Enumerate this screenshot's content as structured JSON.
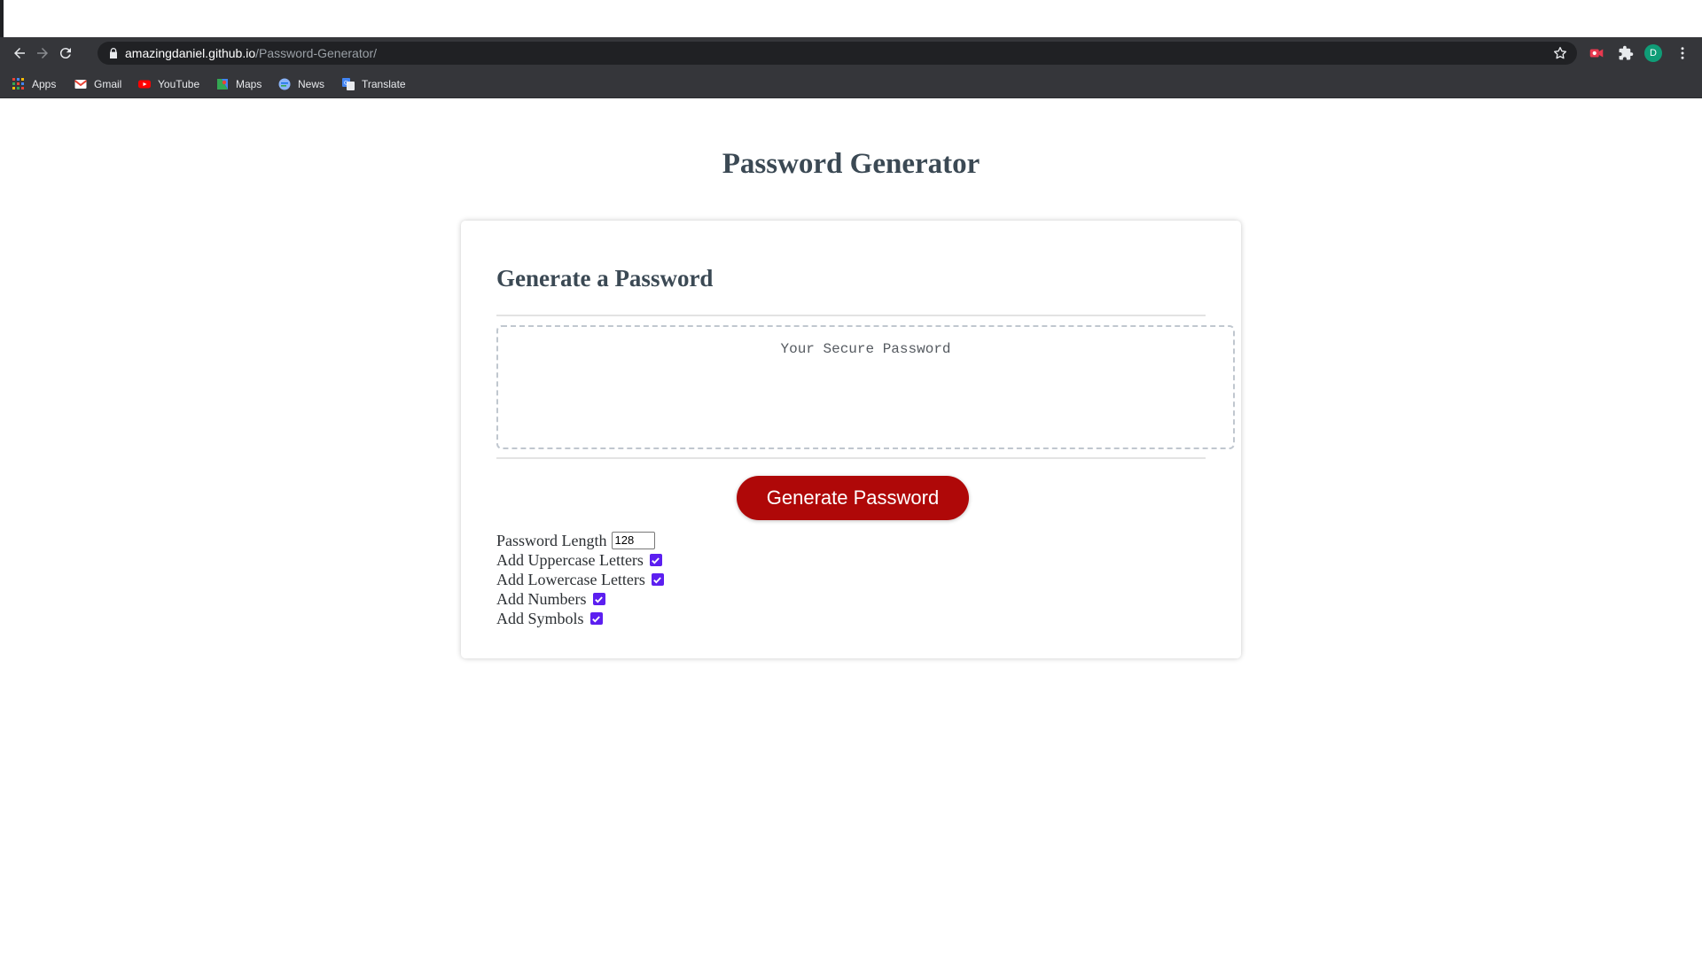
{
  "browser": {
    "url_host": "amazingdaniel.github.io",
    "url_path": "/Password-Generator/",
    "profile_initial": "D",
    "bookmarks": [
      {
        "label": "Apps",
        "icon": "apps-grid-icon"
      },
      {
        "label": "Gmail",
        "icon": "gmail-icon"
      },
      {
        "label": "YouTube",
        "icon": "youtube-icon"
      },
      {
        "label": "Maps",
        "icon": "maps-icon"
      },
      {
        "label": "News",
        "icon": "news-icon"
      },
      {
        "label": "Translate",
        "icon": "translate-icon"
      }
    ]
  },
  "page": {
    "title": "Password Generator",
    "card": {
      "title": "Generate a Password",
      "password_placeholder": "Your Secure Password",
      "generate_label": "Generate Password",
      "options": [
        {
          "label": "Password Length",
          "type": "number",
          "value": "128"
        },
        {
          "label": "Add Uppercase Letters",
          "type": "checkbox",
          "checked": true
        },
        {
          "label": "Add Lowercase Letters",
          "type": "checkbox",
          "checked": true
        },
        {
          "label": "Add Numbers",
          "type": "checkbox",
          "checked": true
        },
        {
          "label": "Add Symbols",
          "type": "checkbox",
          "checked": true
        }
      ]
    }
  },
  "colors": {
    "heading": "#3a4753",
    "button_bg": "#b10909",
    "checkbox_accent": "#5c1ff0",
    "chrome_dark": "#35363a"
  }
}
